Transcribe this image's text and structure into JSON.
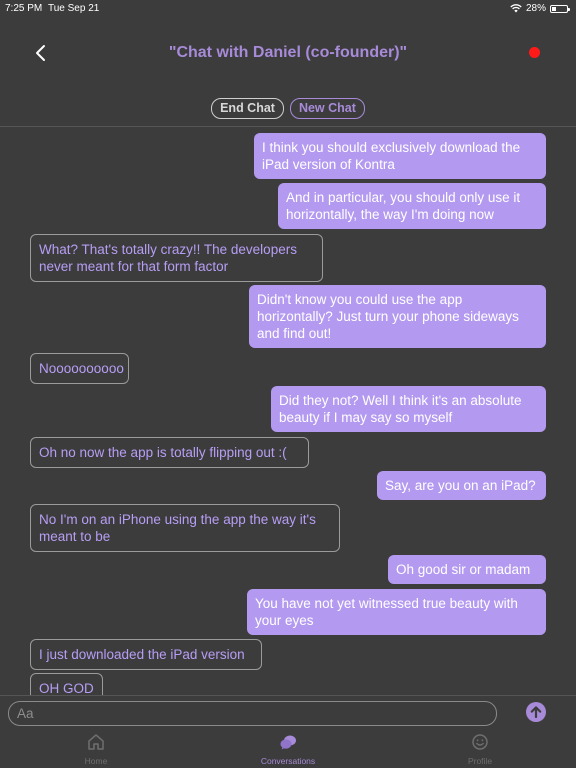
{
  "status": {
    "time": "7:25 PM",
    "date": "Tue Sep 21",
    "battery": "28%",
    "battery_level": 0.28
  },
  "header": {
    "title": "\"Chat with Daniel (co-founder)\""
  },
  "actions": {
    "end_chat": "End Chat",
    "new_chat": "New Chat"
  },
  "messages": [
    {
      "from": "me",
      "text": "I think you should exclusively download the iPad version of Kontra"
    },
    {
      "from": "me",
      "text": "And in particular, you should only use it horizontally, the way I'm doing now"
    },
    {
      "from": "them",
      "text": "What? That's totally crazy!! The developers never meant for that form factor"
    },
    {
      "from": "me",
      "text": "Didn't know you could use the app horizontally? Just turn your phone sideways and find out!"
    },
    {
      "from": "them",
      "text": "Noooooooooo"
    },
    {
      "from": "me",
      "text": "Did they not? Well I think it's an absolute beauty if I may say so myself"
    },
    {
      "from": "them",
      "text": "Oh no now the app is totally flipping out :("
    },
    {
      "from": "me",
      "text": "Say, are you on an iPad?"
    },
    {
      "from": "them",
      "text": "No I'm on an iPhone using the app the way it's meant to be"
    },
    {
      "from": "me",
      "text": "Oh good sir or madam"
    },
    {
      "from": "me",
      "text": "You have not yet witnessed true beauty with your eyes"
    },
    {
      "from": "them",
      "text": "I just downloaded the iPad version"
    },
    {
      "from": "them",
      "text": "OH GOD"
    }
  ],
  "composer": {
    "placeholder": "Aa",
    "value": ""
  },
  "tabs": {
    "home": "Home",
    "conversations": "Conversations",
    "profile": "Profile"
  },
  "colors": {
    "background": "#3c3c3c",
    "accent": "#a78bd8",
    "outgoing_bubble": "#b39af0",
    "recording": "#ff1a1a"
  }
}
